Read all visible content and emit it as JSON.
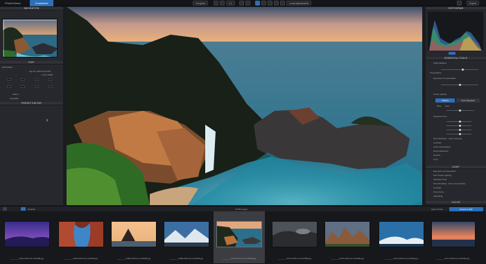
{
  "app": {
    "tabs": [
      {
        "label": "PhotoLibrary"
      },
      {
        "label": "Customize"
      }
    ],
    "toolbar": {
      "compare_label": "Compare",
      "zoom_readout": "1:1",
      "local_adjustments_label": "Local adjustments",
      "export_label": "Export"
    }
  },
  "left_panel": {
    "navigation_header": "NAVIGATION",
    "exif_header": "EXIF",
    "exif_rows": [
      {
        "label": "EXIF Editor",
        "value": ""
      },
      {
        "label": "",
        "value": "Apr 25, 2016  10:23 PM"
      },
      {
        "label": "",
        "value": "F 22  1.0000"
      }
    ],
    "meta_rows": [
      {
        "label": "Author"
      },
      {
        "label": "Copyright"
      }
    ],
    "preset_header": "PRESET EDITOR"
  },
  "right_panel": {
    "histogram_header": "HISTOGRAM",
    "essential_header": "ESSENTIAL TOOLS",
    "essential_rows": [
      {
        "label": "White Balance"
      },
      {
        "label": "Temperature"
      },
      {
        "label": "Exposure Compensation"
      },
      {
        "label": "Smart Lighting"
      }
    ],
    "lighting_buttons": {
      "left": "Uniform",
      "right": "Spot Weighted"
    },
    "lighting_modes": [
      "Slow",
      "Fast"
    ],
    "extra_rows": [
      {
        "label": "Selective Tone"
      },
      {
        "label": "DxO FilmPack - Color Contrast"
      },
      {
        "label": "Contrast"
      },
      {
        "label": "Color Accentuation"
      },
      {
        "label": "Noise Reduction"
      },
      {
        "label": "Horizon"
      },
      {
        "label": "Crop"
      }
    ],
    "light_header": "LIGHT",
    "light_rows": [
      {
        "label": "Exposure Compensation"
      },
      {
        "label": "DxO Smart Lighting"
      },
      {
        "label": "Selective Tone"
      },
      {
        "label": "DxO FilmPack - Fine Contrast Plus"
      },
      {
        "label": "Contrast"
      },
      {
        "label": "Tone Curve"
      },
      {
        "label": "Vignetting"
      }
    ],
    "color_header": "COLOR"
  },
  "filmstrip": {
    "folder_label": "Desktop",
    "count_label": "17/38 Images",
    "export_button": "Export to disk",
    "apply_preset_label": "Apply Preset",
    "thumbnails": [
      {
        "caption": "_______ 0461-5970-16-10-0509.jpg"
      },
      {
        "caption": "_______ 0481-6070-16-10-0509.jpg"
      },
      {
        "caption": "_______ 0482-6078-10-10-0509.jpg"
      },
      {
        "caption": "_______ 0468-0976-10-10-0509.jpg"
      },
      {
        "caption": "_______ 0473-0076-14-10-0509.jpg"
      },
      {
        "caption": "_______ 0474-0970-14-10-0509.jpg"
      },
      {
        "caption": "_______ 0475-0976-13-10-0509.jpg"
      },
      {
        "caption": "_______ 0476-0976-11-10-0509.jpg"
      },
      {
        "caption": "_______ 0477-0978-12-10-0509.jpg"
      }
    ]
  },
  "colors": {
    "accent": "#2d6fb8",
    "panel": "#26282d",
    "background": "#1b1c1f"
  }
}
